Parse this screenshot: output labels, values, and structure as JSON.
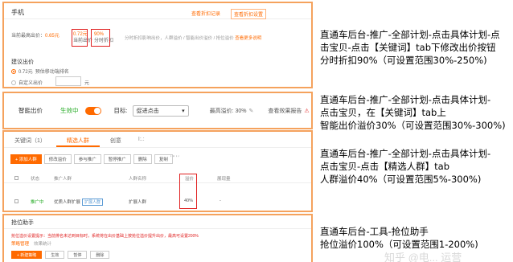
{
  "panel1": {
    "title": "手机",
    "link_history": "查看折扣记录",
    "link_settings": "查看折扣设置",
    "row_label": "当前最高出价：",
    "current_price": "0.65元",
    "bid_value": "0.72元",
    "bid_sub": "当前出价",
    "pct_value": "90%",
    "pct_sub": "分时折扣",
    "desc": "分时折扣影响出价，人群溢价 / 智能出价溢价 / 抢位溢价",
    "desc_link": "查看更多说明",
    "suggest_title": "建议出价",
    "opt1": "0.72元",
    "opt1_hint": "预估移动端排名",
    "opt2": "自定义出价",
    "unit": "元"
  },
  "panel2": {
    "smart_bid": "智能出价",
    "status": "生效中",
    "goal_label": "目标:",
    "goal_value": "促进点击",
    "max_premium": "最高溢价: 30%",
    "view_report": "查看效果报告",
    "warn_icon": "warning-icon"
  },
  "panel3": {
    "tabs": [
      "关键词（1）",
      "精选人群",
      "创意"
    ],
    "tab_extra": "I:.:",
    "toolbar": [
      "+ 添加人群",
      "修改溢价",
      "参与推广",
      "暂停推广",
      "删除",
      "复制"
    ],
    "blur": "′  ′′  ′  ′",
    "headers": [
      "状态",
      "推广人群",
      "人群名称",
      "溢价",
      "展现量"
    ],
    "row": {
      "status": "推广中",
      "crowd": "优质人群扩展",
      "crowd_tag": "扩展人群",
      "name": "扩展人群",
      "premium": "40%",
      "views": "-"
    }
  },
  "panel4": {
    "title": "抢位助手",
    "hint": "抢位溢价设置提示：当前排名未达到目标时，系统将在出价基础上按抢位溢价提升出价，最高可设置200%",
    "tabs": [
      "策略管理",
      "效果统计"
    ],
    "buttons": [
      "+ 新建策略",
      "生效",
      "暂停",
      "删除"
    ]
  },
  "notes": {
    "n1": [
      "直通车后台-推广-全部计划-点击具体计划-点",
      "击宝贝-点击【关键词】tab下修改出价按钮",
      "分时折扣90%（可设置范围30%-250%)"
    ],
    "n2": [
      "直通车后台-推广-全部计划-点击具体计划-",
      "点击宝贝，在【关键词】tab上",
      "智能出价溢价30%（可设置范围30%-300%)"
    ],
    "n3": [
      "直通车后台-推广-全部计划-点击具体计划-",
      "点击宝贝-点击【精选人群】tab",
      "人群溢价40%（可设置范围5%-300%)"
    ],
    "n4": [
      "直通车后台-工具-抢位助手",
      "抢位溢价100%（可设置范围1-200%)"
    ]
  },
  "watermark": "知乎 @电... 运营"
}
